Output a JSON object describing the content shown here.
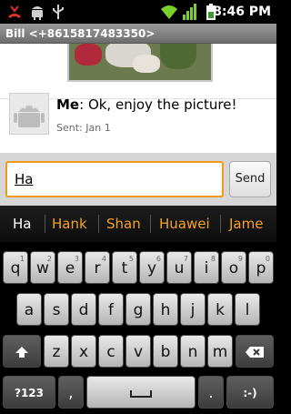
{
  "status_bar": {
    "time": "8:46 PM",
    "icons": [
      "missed-call-icon",
      "robot-icon",
      "usb-icon",
      "wifi-icon",
      "signal-icon",
      "battery-icon"
    ]
  },
  "header": {
    "title": "Bill <+8615817483350>"
  },
  "conversation": {
    "message": {
      "sender": "Me",
      "separator": ": ",
      "text": "Ok, enjoy the picture!",
      "time": "Sent: Jan 1"
    }
  },
  "compose": {
    "value": "Ha",
    "send_label": "Send",
    "accent": "#f39a1e"
  },
  "suggestions": {
    "typed": "Ha",
    "items": [
      "Hank",
      "Shan",
      "Huawei",
      "Jame"
    ],
    "color": "#f7a323"
  },
  "keyboard": {
    "row1": [
      "q",
      "w",
      "e",
      "r",
      "t",
      "y",
      "u",
      "i",
      "o",
      "p"
    ],
    "row1_hints": [
      "1",
      "2",
      "3",
      "4",
      "5",
      "6",
      "7",
      "8",
      "9",
      "0"
    ],
    "row2": [
      "a",
      "s",
      "d",
      "f",
      "g",
      "h",
      "j",
      "k",
      "l"
    ],
    "row3": [
      "z",
      "x",
      "c",
      "v",
      "b",
      "n",
      "m"
    ],
    "symbols_label": "?123",
    "comma": ",",
    "period": ".",
    "smiley": ":-)"
  }
}
